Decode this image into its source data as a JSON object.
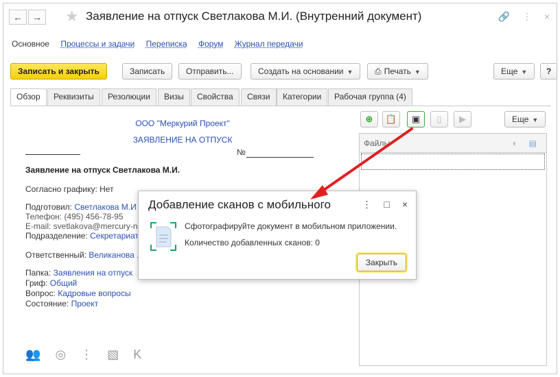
{
  "window": {
    "title": "Заявление на отпуск Светлакова М.И. (Внутренний документ)",
    "back_icon": "←",
    "forward_icon": "→",
    "star_icon": "★",
    "link_icon": "🔗",
    "more_icon": "⋮",
    "close_icon": "×"
  },
  "nav": {
    "items": [
      "Основное",
      "Процессы и задачи",
      "Переписка",
      "Форум",
      "Журнал передачи"
    ]
  },
  "toolbar": {
    "save_close": "Записать и закрыть",
    "save": "Записать",
    "send": "Отправить...",
    "create_based": "Создать на основании",
    "print": "Печать",
    "print_icon": "🖶",
    "more": "Еще",
    "help": "?"
  },
  "tabs": [
    "Обзор",
    "Реквизиты",
    "Резолюции",
    "Визы",
    "Свойства",
    "Связи",
    "Категории",
    "Рабочая группа (4)"
  ],
  "doc": {
    "org": "ООО \"Меркурий Проект\"",
    "doc_type": "ЗАЯВЛЕНИЕ НА ОТПУСК",
    "number_label": "№",
    "heading": "Заявление на отпуск Светлакова М.И.",
    "schedule_label": "Согласно графику:",
    "schedule_value": "Нет",
    "prepared_label": "Подготовил:",
    "prepared_value": "Светлакова М.И",
    "phone": "Телефон: (495) 456-78-95",
    "email": "E-mail: svetlakova@mercury-n",
    "dept_label": "Подразделение:",
    "dept_value": "Секретариат",
    "resp_label": "Ответственный:",
    "resp_value": "Великанова .",
    "folder_label": "Папка:",
    "folder_value": "Заявления на отпуск",
    "stamp_label": "Гриф:",
    "stamp_value": "Общий",
    "question_label": "Вопрос:",
    "question_value": "Кадровые вопросы",
    "state_label": "Состояние:",
    "state_value": "Проект",
    "bottom_letter": "K"
  },
  "files": {
    "more": "Еще",
    "column": "Файлы"
  },
  "dialog": {
    "title": "Добавление сканов с мобильного",
    "instruction": "Сфотографируйте документ в мобильном приложении.",
    "count_label": "Количество добавленных сканов:",
    "count_value": "0",
    "close_button": "Закрыть",
    "more_icon": "⋮",
    "maximize_icon": "□",
    "close_icon": "×"
  },
  "colors": {
    "accent_yellow": "#f5cf10",
    "link_blue": "#2a4fb0",
    "arrow_red": "#e02020"
  }
}
